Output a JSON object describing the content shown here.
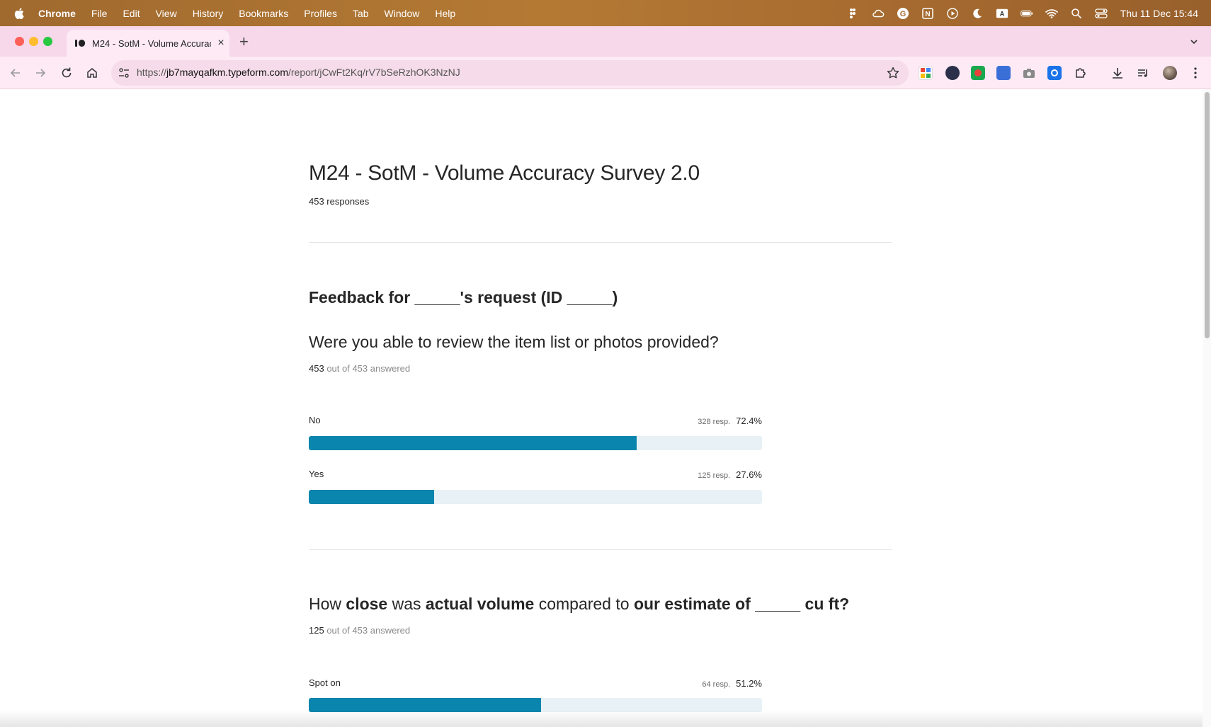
{
  "menubar": {
    "app": "Chrome",
    "items": [
      "File",
      "Edit",
      "View",
      "History",
      "Bookmarks",
      "Profiles",
      "Tab",
      "Window",
      "Help"
    ],
    "clock": "Thu 11 Dec  15:44"
  },
  "tab": {
    "title": "M24 - SotM - Volume Accuracy Survey 2.0"
  },
  "toolbar": {
    "url_prefix": "https://",
    "url_host": "jb7mayqafkm.typeform.com",
    "url_path": "/report/jCwFt2Kq/rV7bSeRzhOK3NzNJ"
  },
  "report": {
    "title": "M24 - SotM - Volume Accuracy Survey 2.0",
    "responses": "453 responses"
  },
  "section": {
    "title": "Feedback for _____'s request (ID _____)"
  },
  "q1": {
    "text": "Were you able to review the item list or photos provided?",
    "answered_num": "453",
    "answered_rest": " out of 453 answered",
    "options": [
      {
        "label": "No",
        "resp": "328 resp.",
        "pct": "72.4%",
        "value": 72.4
      },
      {
        "label": "Yes",
        "resp": "125 resp.",
        "pct": "27.6%",
        "value": 27.6
      }
    ]
  },
  "q2": {
    "t1": "How ",
    "t2": "close",
    "t3": " was ",
    "t4": "actual volume",
    "t5": " compared to ",
    "t6": "our estimate of _____ cu ft?",
    "answered_num": "125",
    "answered_rest": " out of 453 answered",
    "options": [
      {
        "label": "Spot on",
        "resp": "64 resp.",
        "pct": "51.2%",
        "value": 51.2
      }
    ]
  },
  "colors": {
    "bar_fill": "#0a85ad",
    "bar_track": "#e8f1f5"
  }
}
